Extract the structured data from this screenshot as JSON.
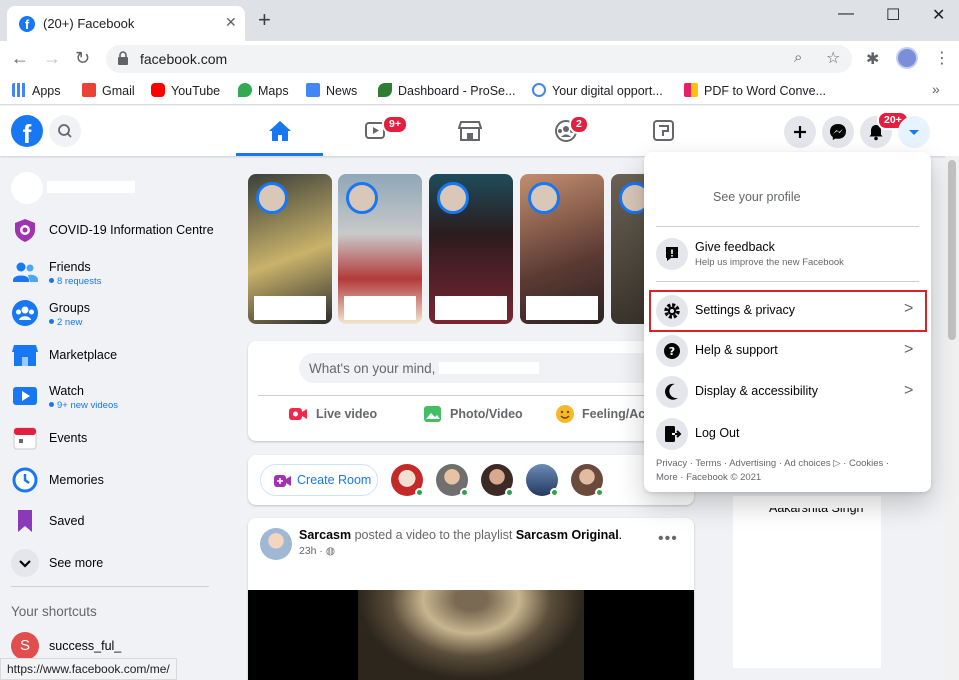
{
  "browser": {
    "tab_title": "(20+) Facebook",
    "url": "facebook.com",
    "status_url": "https://www.facebook.com/me/"
  },
  "bookmarks": [
    {
      "label": "Apps",
      "color": "#4285f4"
    },
    {
      "label": "Gmail",
      "color": "#ea4335"
    },
    {
      "label": "YouTube",
      "color": "#ff0000"
    },
    {
      "label": "Maps",
      "color": "#34a853"
    },
    {
      "label": "News",
      "color": "#4285f4"
    },
    {
      "label": "Dashboard - ProSe...",
      "color": "#2e7d32"
    },
    {
      "label": "Your digital opport...",
      "color": "#4285f4"
    },
    {
      "label": "PDF to Word Conve...",
      "color": "#e91e63"
    }
  ],
  "header": {
    "watch_badge": "9+",
    "groups_badge": "2",
    "notif_badge": "20+"
  },
  "sidebar": {
    "items": [
      {
        "label": "COVID-19 Information Centre",
        "sub": ""
      },
      {
        "label": "Friends",
        "sub": "8 requests"
      },
      {
        "label": "Groups",
        "sub": "2 new"
      },
      {
        "label": "Marketplace",
        "sub": ""
      },
      {
        "label": "Watch",
        "sub": "9+ new videos"
      },
      {
        "label": "Events",
        "sub": ""
      },
      {
        "label": "Memories",
        "sub": ""
      },
      {
        "label": "Saved",
        "sub": ""
      },
      {
        "label": "See more",
        "sub": ""
      }
    ],
    "shortcuts_title": "Your shortcuts",
    "shortcut": "success_ful_"
  },
  "composer": {
    "placeholder": "What's on your mind,",
    "live": "Live video",
    "photo": "Photo/Video",
    "feeling": "Feeling/Act"
  },
  "rooms": {
    "create": "Create Room"
  },
  "post": {
    "author": "Sarcasm",
    "action": "posted a video to the playlist",
    "playlist": "Sarcasm Original",
    "time": "23h ·"
  },
  "menu": {
    "see_profile": "See your profile",
    "feedback_title": "Give feedback",
    "feedback_sub": "Help us improve the new Facebook",
    "settings": "Settings & privacy",
    "help": "Help & support",
    "display": "Display & accessibility",
    "logout": "Log Out",
    "footer1": "Privacy · Terms · Advertising · Ad choices ▷ · Cookies ·",
    "footer2": "More · Facebook © 2021"
  },
  "contacts_partial": "Aakarshita Singh"
}
